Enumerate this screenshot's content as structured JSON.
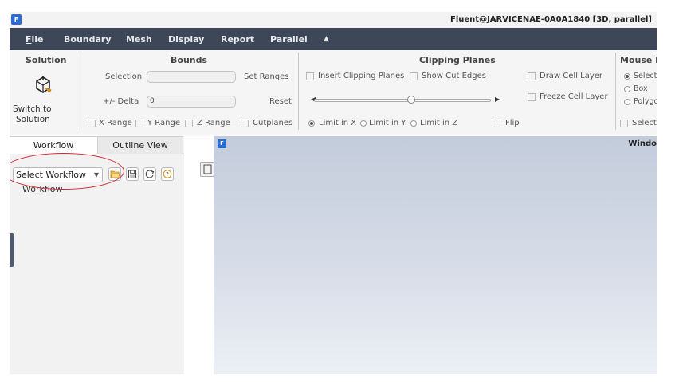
{
  "titlebar": {
    "logo": "F",
    "title": "Fluent@JARVICENAE-0A0A1840  [3D, parallel]"
  },
  "menu": {
    "file_first": "F",
    "file_rest": "ile",
    "items": [
      "Boundary",
      "Mesh",
      "Display",
      "Report",
      "Parallel"
    ],
    "collapse_icon": "▲"
  },
  "ribbon": {
    "solution": {
      "title": "Solution",
      "button_line1": "Switch to",
      "button_line2": "Solution"
    },
    "bounds": {
      "title": "Bounds",
      "selection_label": "Selection",
      "selection_value": "",
      "delta_label": "+/- Delta",
      "delta_value": "0",
      "set_ranges": "Set Ranges",
      "reset": "Reset",
      "x_range": "X Range",
      "y_range": "Y Range",
      "z_range": "Z Range",
      "cutplanes": "Cutplanes"
    },
    "clipping": {
      "title": "Clipping Planes",
      "insert": "Insert Clipping Planes",
      "show_cut_edges": "Show Cut Edges",
      "draw_cell_layer": "Draw Cell Layer",
      "freeze_cell_layer": "Freeze Cell Layer",
      "left_arrow": "◀",
      "right_arrow": "▶",
      "limit_x": "Limit in X",
      "limit_y": "Limit in Y",
      "limit_z": "Limit in Z",
      "flip": "Flip",
      "slider_fraction": 0.55
    },
    "mouse": {
      "title": "Mouse P",
      "select": "Select",
      "box": "Box",
      "polygon": "Polygo",
      "select_check": "Select"
    }
  },
  "left_panel": {
    "tabs": [
      "Workflow",
      "Outline View"
    ],
    "select_workflow": "Select Workflow",
    "dropdown_icon": "▼",
    "workflow_label": "Workflow"
  },
  "graphics": {
    "logo": "F",
    "title": "Windo"
  },
  "colors": {
    "menubar": "#3d4757",
    "accent": "#2a6ad1",
    "annotation": "#d0262d"
  }
}
